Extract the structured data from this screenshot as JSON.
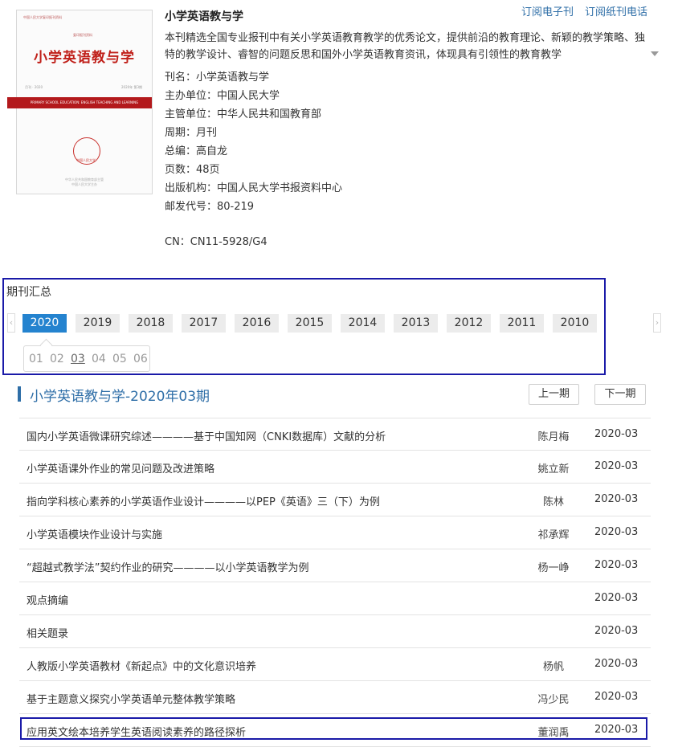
{
  "journal": {
    "title": "小学英语教与学",
    "description": "本刊精选全国专业报刊中有关小学英语教育教学的优秀论文，提供前沿的教育理论、新颖的教学策略、独特的教学设计、睿智的问题反思和国外小学英语教育资讯，体现具有引领性的教育教学",
    "meta": [
      "刊名：小学英语教与学",
      "主办单位：中国人民大学",
      "主管单位：中华人民共和国教育部",
      "周期：月刊",
      "总编：高自龙",
      "页数：48页",
      "出版机构：中国人民大学书报资料中心",
      "邮发代号：80-219"
    ],
    "cn": "CN：CN11-5928/G4"
  },
  "cover": {
    "small_top": "中国人民大学复印报刊资料",
    "small_sub": "复印报刊资料",
    "title": "小学英语教与学",
    "meta_left": "月刊 · 2020",
    "meta_right": "2020年 第3期",
    "band_text": "PRIMARY SCHOOL EDUCATION: ENGLISH TEACHING AND LEARNING",
    "seal_text": "中国人民大学",
    "foot_1": "中华人民共和国教育部主管",
    "foot_2": "中国人民大学主办"
  },
  "links": {
    "subscribe_e": "订阅电子刊",
    "subscribe_paper": "订阅纸刊电话"
  },
  "archive": {
    "heading": "期刊汇总",
    "prev_arrow": "‹",
    "next_arrow": "›",
    "years": [
      "2020",
      "2019",
      "2018",
      "2017",
      "2016",
      "2015",
      "2014",
      "2013",
      "2012",
      "2011",
      "2010"
    ],
    "active_year": "2020",
    "months": [
      "01",
      "02",
      "03",
      "04",
      "05",
      "06"
    ],
    "active_month": "03"
  },
  "issue": {
    "title": "小学英语教与学-2020年03期",
    "prev_label": "上一期",
    "next_label": "下一期"
  },
  "articles": [
    {
      "title": "国内小学英语微课研究综述————基于中国知网（CNKI数据库）文献的分析",
      "author": "陈月梅",
      "date": "2020-03"
    },
    {
      "title": "小学英语课外作业的常见问题及改进策略",
      "author": "姚立新",
      "date": "2020-03"
    },
    {
      "title": "指向学科核心素养的小学英语作业设计————以PEP《英语》三（下）为例",
      "author": "陈林",
      "date": "2020-03"
    },
    {
      "title": "小学英语模块作业设计与实施",
      "author": "祁承辉",
      "date": "2020-03"
    },
    {
      "title": "“超越式教学法”契约作业的研究————以小学英语教学为例",
      "author": "杨一峥",
      "date": "2020-03"
    },
    {
      "title": "观点摘编",
      "author": "",
      "date": "2020-03"
    },
    {
      "title": "相关题录",
      "author": "",
      "date": "2020-03"
    },
    {
      "title": "人教版小学英语教材《新起点》中的文化意识培养",
      "author": "杨帆",
      "date": "2020-03"
    },
    {
      "title": "基于主题意义探究小学英语单元整体教学策略",
      "author": "冯少民",
      "date": "2020-03"
    },
    {
      "title": "应用英文绘本培养学生英语阅读素养的路径探析",
      "author": "董润禹",
      "date": "2020-03"
    }
  ]
}
